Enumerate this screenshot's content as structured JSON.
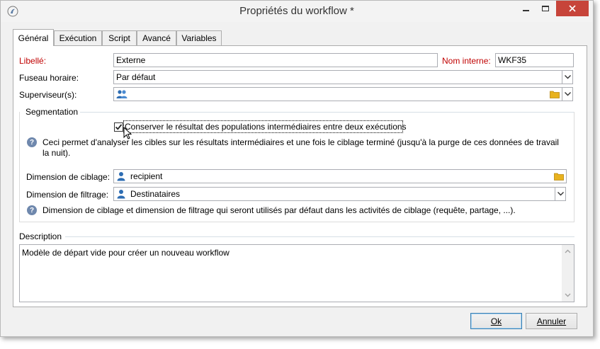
{
  "window": {
    "title": "Propriétés du workflow *"
  },
  "tabs": [
    {
      "label": "Général",
      "active": true
    },
    {
      "label": "Exécution",
      "active": false
    },
    {
      "label": "Script",
      "active": false
    },
    {
      "label": "Avancé",
      "active": false
    },
    {
      "label": "Variables",
      "active": false
    }
  ],
  "general": {
    "label_label": "Libellé:",
    "label_value": "Externe",
    "internal_name_label": "Nom interne:",
    "internal_name_value": "WKF35",
    "timezone_label": "Fuseau horaire:",
    "timezone_value": "Par défaut",
    "supervisor_label": "Superviseur(s):",
    "supervisor_value": ""
  },
  "segmentation": {
    "title": "Segmentation",
    "keep_checkbox_label": "Conserver le résultat des populations intermédiaires entre deux exécutions",
    "keep_checked": true,
    "info_1": "Ceci permet d'analyser les cibles sur les résultats intermédiaires et une fois le ciblage terminé (jusqu'à la purge de ces données de travail la nuit).",
    "targeting_dimension_label": "Dimension de ciblage:",
    "targeting_dimension_value": "recipient",
    "filtering_dimension_label": "Dimension de filtrage:",
    "filtering_dimension_value": "Destinataires",
    "info_2": "Dimension de ciblage et dimension de filtrage qui seront utilisés par défaut dans les activités de ciblage (requête, partage, ...)."
  },
  "description": {
    "title": "Description",
    "value": "Modèle de départ vide pour créer un nouveau workflow"
  },
  "buttons": {
    "ok": "Ok",
    "cancel": "Annuler"
  },
  "colors": {
    "required_label": "#c00000",
    "close_button": "#c7443a",
    "folder_icon": "#e8b21e",
    "user_icon": "#2d6db3"
  }
}
